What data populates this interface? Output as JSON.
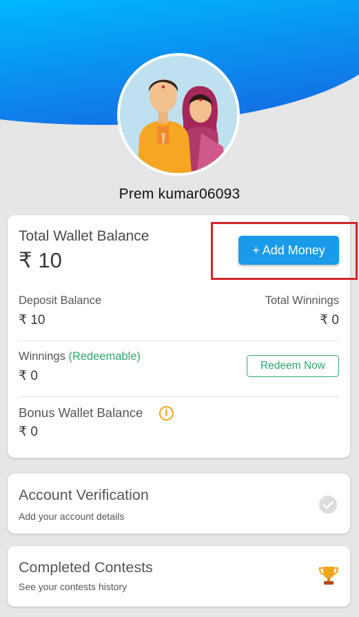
{
  "profile": {
    "username": "Prem kumar06093"
  },
  "wallet": {
    "total_label": "Total Wallet Balance",
    "total_value": "₹ 10",
    "add_money_label": "+ Add Money",
    "deposit_label": "Deposit Balance",
    "deposit_value": "₹ 10",
    "total_winnings_label": "Total Winnings",
    "total_winnings_value": "₹ 0",
    "winnings_label": "Winnings",
    "winnings_tag": "(Redeemable)",
    "winnings_value": "₹ 0",
    "redeem_label": "Redeem Now",
    "bonus_label": "Bonus Wallet Balance",
    "bonus_value": "₹ 0",
    "info_icon_glyph": "i"
  },
  "verification": {
    "title": "Account Verification",
    "subtitle": "Add your account details",
    "icon": "check-circle-icon"
  },
  "contests": {
    "title": "Completed Contests",
    "subtitle": "See your contests history",
    "icon": "trophy-icon"
  },
  "colors": {
    "header_gradient_start": "#00b4ff",
    "header_gradient_end": "#1273e8",
    "accent_blue": "#1a9be9",
    "green": "#2ea56a",
    "highlight_red": "#d4242b",
    "info_orange": "#f0a51c"
  }
}
